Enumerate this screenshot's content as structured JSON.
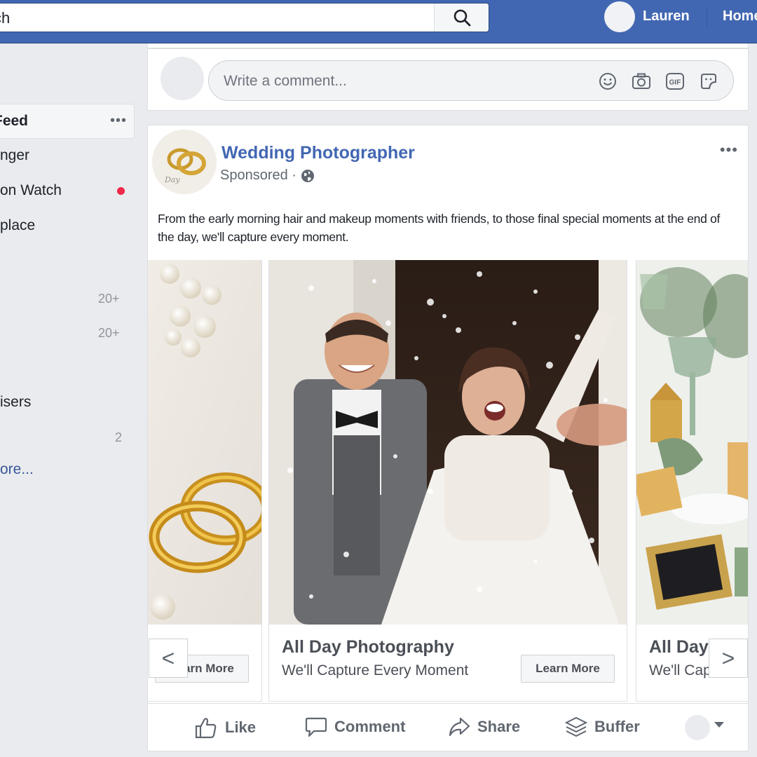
{
  "topbar": {
    "search_value": "ch",
    "user_name": "Lauren",
    "home_label": "Home"
  },
  "sidebar": {
    "items": [
      {
        "label": "Feed"
      },
      {
        "label": "nger"
      },
      {
        "label": "on Watch"
      },
      {
        "label": "place"
      },
      {
        "label": "isers"
      }
    ],
    "counts": [
      "20+",
      "20+",
      "2"
    ],
    "see_more": "ore..."
  },
  "comment_box": {
    "placeholder": "Write a comment..."
  },
  "post": {
    "page_name": "Wedding Photographer",
    "sponsored": "Sponsored ·",
    "text": "From the early morning hair and makeup moments with friends, to those final special moments at the end of the day, we'll capture every moment.",
    "carousel": [
      {
        "button": "Learn More"
      },
      {
        "title": "All Day Photography",
        "subtitle": "We'll Capture Every Moment",
        "button": "Learn More"
      },
      {
        "title": "All Day Pho",
        "subtitle": "We'll Capture"
      }
    ],
    "prev_arrow": "<",
    "next_arrow": ">",
    "actions": {
      "like": "Like",
      "comment": "Comment",
      "share": "Share",
      "buffer": "Buffer"
    }
  },
  "colors": {
    "brand": "#4267b2",
    "notification": "#f02849"
  }
}
